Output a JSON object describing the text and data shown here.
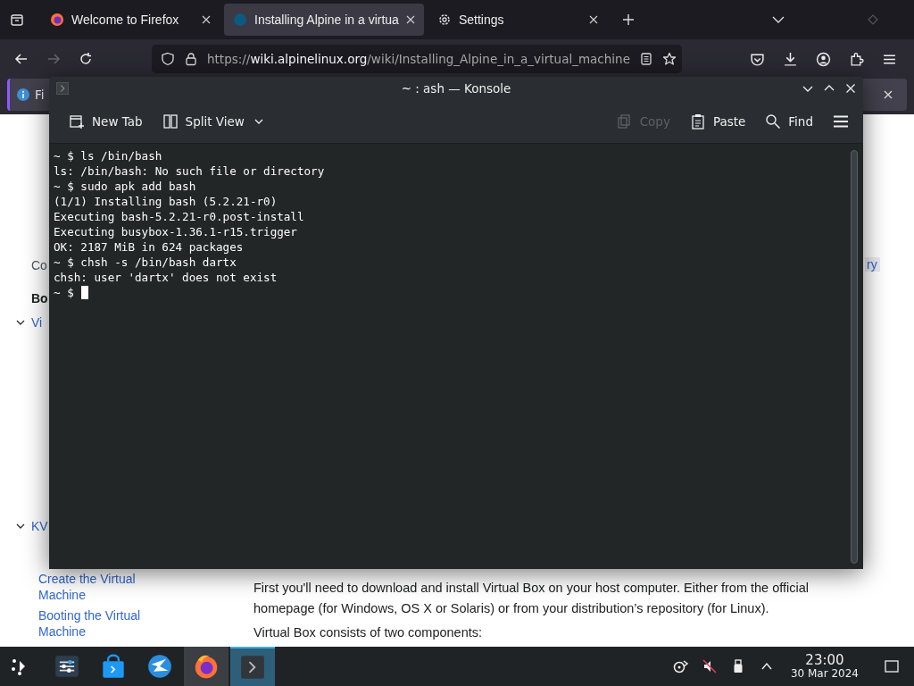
{
  "browser": {
    "tabs": [
      {
        "title": "Welcome to Firefox",
        "kind": "firefox",
        "selected": false
      },
      {
        "title": "Installing Alpine in a virtua",
        "kind": "wiki",
        "selected": true
      },
      {
        "title": "Settings",
        "kind": "settings",
        "selected": false
      }
    ],
    "url": {
      "scheme": "https://",
      "domain": "wiki.alpinelinux.org",
      "path": "/wiki/Installing_Alpine_in_a_virtual_machine"
    },
    "notification": "Fi"
  },
  "page": {
    "sidebar": [
      {
        "kind": "label",
        "text": "Co"
      },
      {
        "kind": "heading",
        "text": "Bo"
      },
      {
        "kind": "section",
        "text": "Vi",
        "expanded": true
      },
      {
        "kind": "section",
        "text": "KV",
        "expanded": true
      },
      {
        "kind": "link",
        "text": "Create the Virtual Machine"
      },
      {
        "kind": "link",
        "text": "Booting the Virtual Machine"
      }
    ],
    "toc_fragment": "ry",
    "paragraphs": [
      "First you'll need to download and install Virtual Box on your host computer. Either from the official homepage (for Windows, OS X or Solaris) or from your distribution’s repository (for Linux).",
      "Virtual Box consists of two components:"
    ]
  },
  "konsole": {
    "title": "~ : ash — Konsole",
    "toolbar": [
      {
        "kind": "new-tab",
        "label": "New Tab",
        "disabled": false
      },
      {
        "kind": "split",
        "label": "Split View",
        "disabled": false
      },
      {
        "kind": "copy",
        "label": "Copy",
        "disabled": true
      },
      {
        "kind": "paste",
        "label": "Paste",
        "disabled": false
      },
      {
        "kind": "find",
        "label": "Find",
        "disabled": false
      }
    ],
    "lines": [
      "~ $ ls /bin/bash",
      "ls: /bin/bash: No such file or directory",
      "~ $ sudo apk add bash",
      "(1/1) Installing bash (5.2.21-r0)",
      "Executing bash-5.2.21-r0.post-install",
      "Executing busybox-1.36.1-r15.trigger",
      "OK: 2187 MiB in 624 packages",
      "~ $ chsh -s /bin/bash dartx",
      "chsh: user 'dartx' does not exist",
      "~ $"
    ],
    "cursor": true
  },
  "taskbar": {
    "apps": [
      {
        "kind": "settings",
        "active": false
      },
      {
        "kind": "store",
        "active": false
      },
      {
        "kind": "browser-globe",
        "active": false
      },
      {
        "kind": "firefox",
        "active": true
      },
      {
        "kind": "terminal",
        "active": true
      }
    ],
    "muted": true,
    "time": "23:00",
    "date": "30 Mar 2024"
  }
}
